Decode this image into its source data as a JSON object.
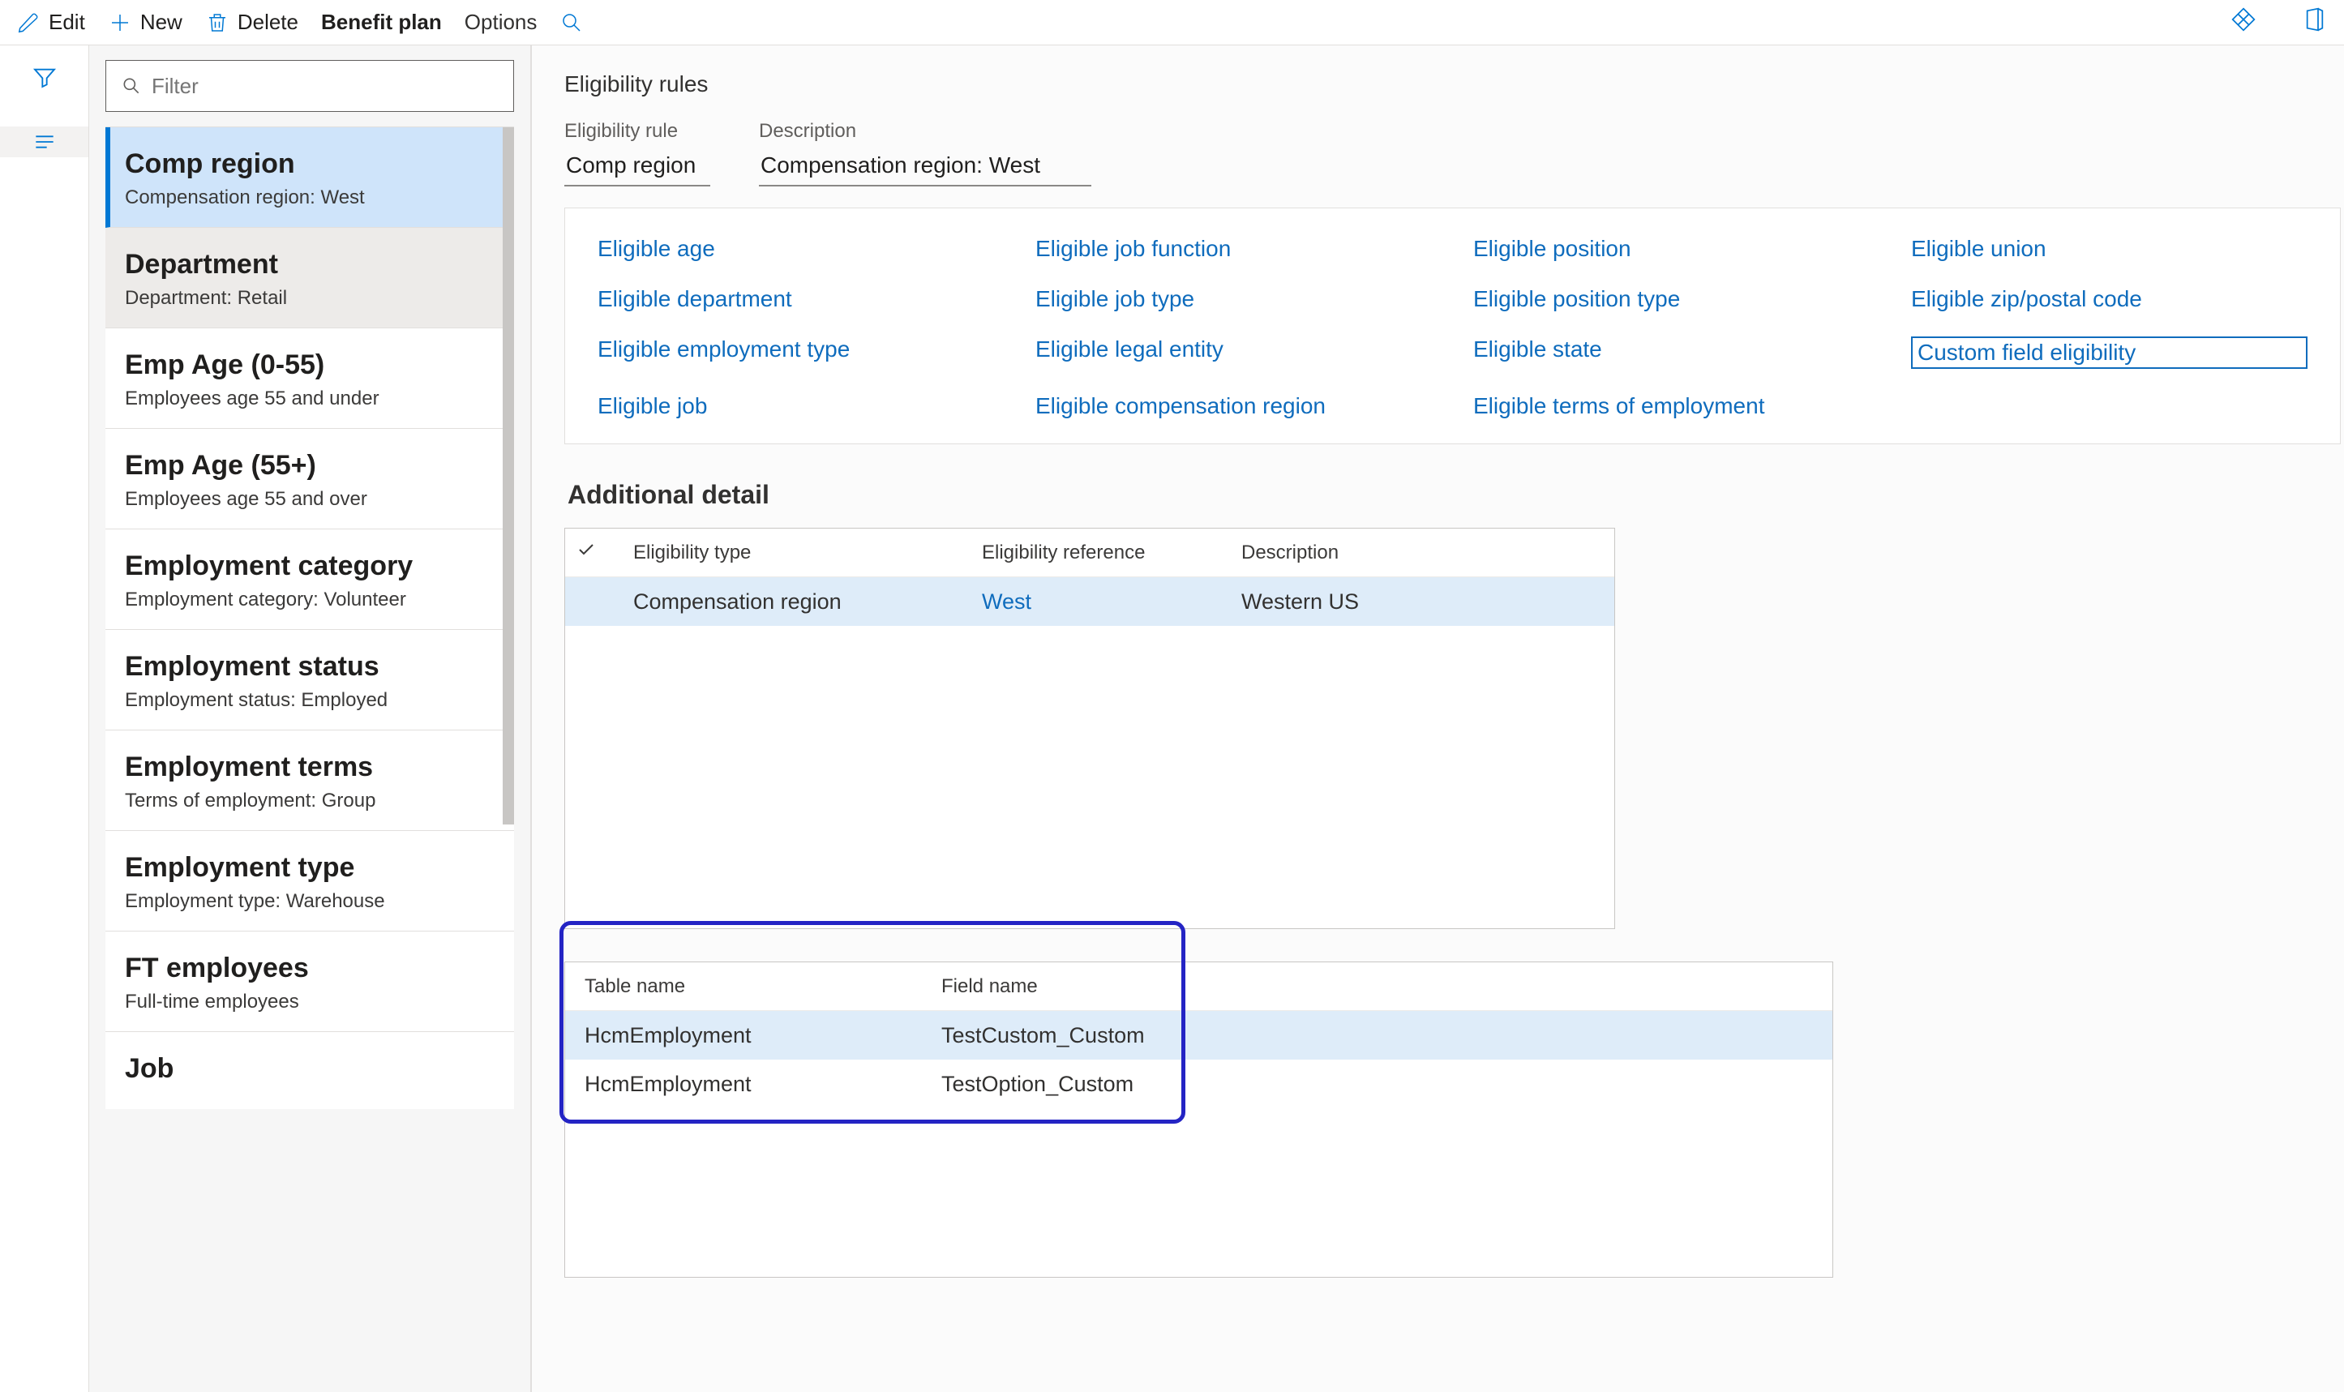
{
  "actions": {
    "edit": "Edit",
    "new": "New",
    "delete": "Delete",
    "benefit_plan": "Benefit plan",
    "options": "Options"
  },
  "filter": {
    "placeholder": "Filter"
  },
  "rules": [
    {
      "title": "Comp region",
      "sub": "Compensation region:  West"
    },
    {
      "title": "Department",
      "sub": "Department:  Retail"
    },
    {
      "title": "Emp Age (0-55)",
      "sub": "Employees age 55 and under"
    },
    {
      "title": "Emp Age (55+)",
      "sub": "Employees age 55 and over"
    },
    {
      "title": "Employment category",
      "sub": "Employment category:  Volunteer"
    },
    {
      "title": "Employment status",
      "sub": "Employment status: Employed"
    },
    {
      "title": "Employment terms",
      "sub": "Terms of employment: Group"
    },
    {
      "title": "Employment type",
      "sub": "Employment type: Warehouse"
    },
    {
      "title": "FT employees",
      "sub": "Full-time employees"
    },
    {
      "title": "Job",
      "sub": ""
    }
  ],
  "page": {
    "title": "Eligibility rules",
    "rule_label": "Eligibility rule",
    "rule_value": "Comp region",
    "desc_label": "Description",
    "desc_value": "Compensation region:  West"
  },
  "links": {
    "c0": [
      "Eligible age",
      "Eligible department",
      "Eligible employment type",
      "Eligible job"
    ],
    "c1": [
      "Eligible job function",
      "Eligible job type",
      "Eligible legal entity",
      "Eligible compensation region"
    ],
    "c2": [
      "Eligible position",
      "Eligible position type",
      "Eligible state",
      "Eligible terms of employment"
    ],
    "c3": [
      "Eligible union",
      "Eligible zip/postal code",
      "Custom field eligibility"
    ]
  },
  "section_additional": "Additional detail",
  "grid1": {
    "headers": {
      "type": "Eligibility type",
      "ref": "Eligibility reference",
      "desc": "Description"
    },
    "row": {
      "type": "Compensation region",
      "ref": "West",
      "desc": "Western US"
    }
  },
  "grid2": {
    "headers": {
      "table": "Table name",
      "field": "Field name"
    },
    "rows": [
      {
        "table": "HcmEmployment",
        "field": "TestCustom_Custom"
      },
      {
        "table": "HcmEmployment",
        "field": "TestOption_Custom"
      }
    ]
  }
}
